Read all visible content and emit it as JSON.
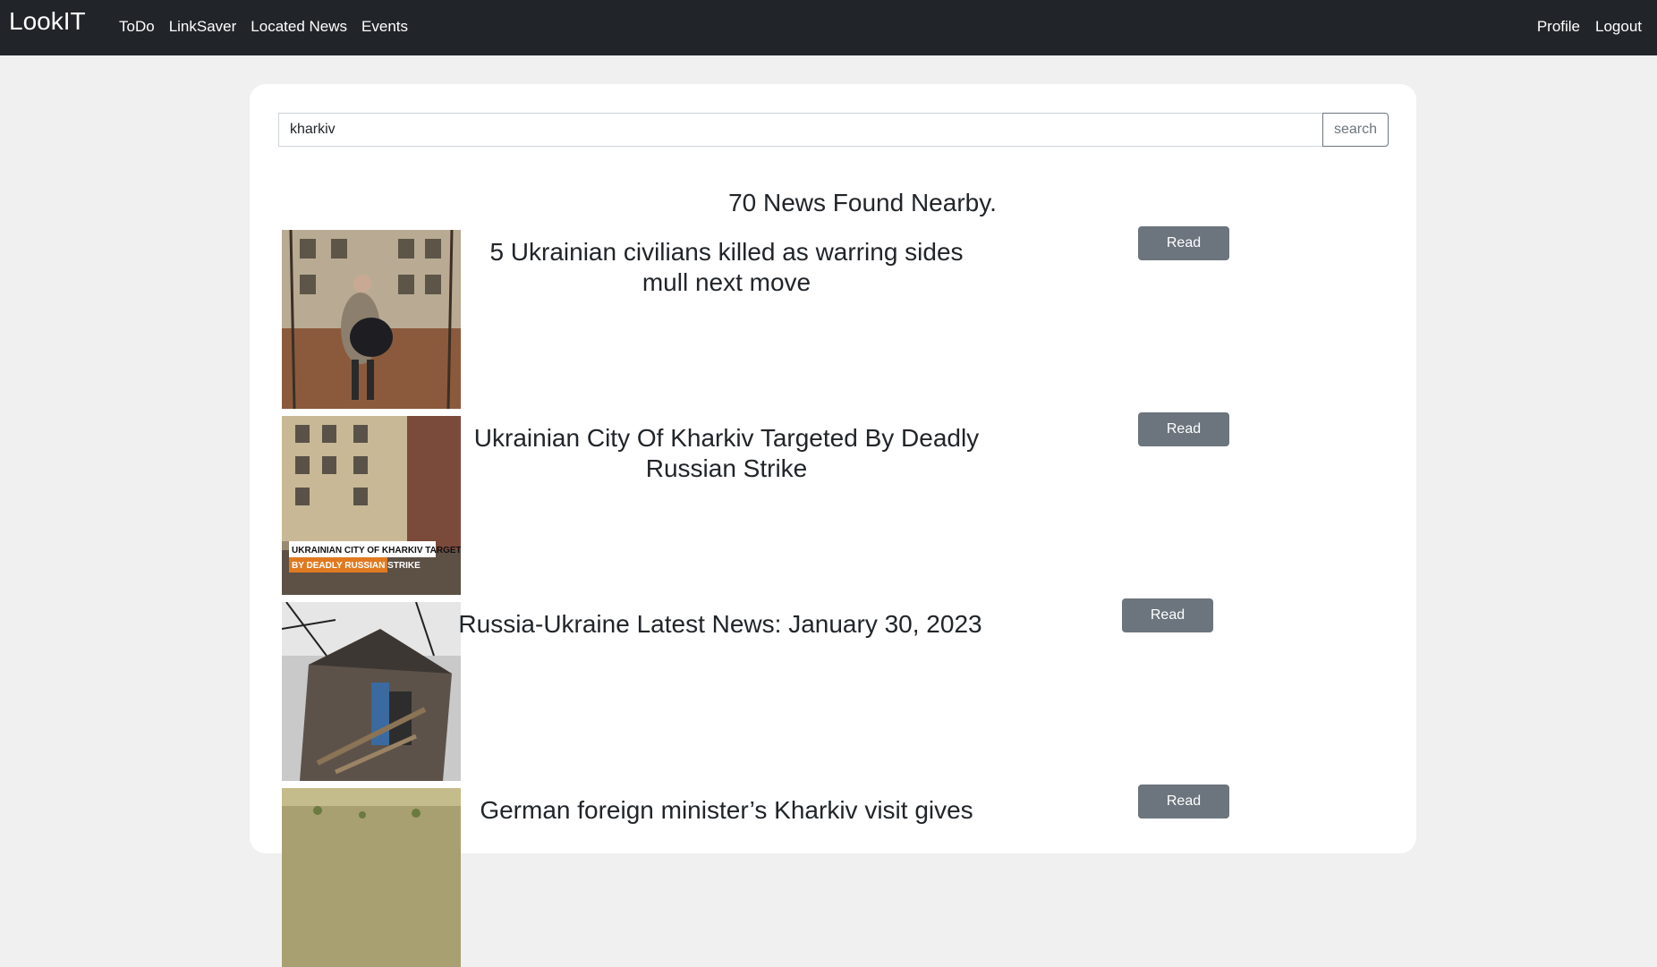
{
  "navbar": {
    "brand": "LookIT",
    "links": [
      "ToDo",
      "LinkSaver",
      "Located News",
      "Events"
    ],
    "right_links": [
      "Profile",
      "Logout"
    ]
  },
  "search": {
    "value": "kharkiv",
    "button_label": "search"
  },
  "results": {
    "count_text": "70 News Found Nearby."
  },
  "news": [
    {
      "title": "5 Ukrainian civilians killed as warring sides mull next move",
      "button": "Read"
    },
    {
      "title": "Ukrainian City Of Kharkiv Targeted By Deadly Russian Strike",
      "button": "Read",
      "caption_line1": "UKRAINIAN CITY OF KHARKIV TARGETED",
      "caption_line2": "BY DEADLY RUSSIAN STRIKE"
    },
    {
      "title": "Russia-Ukraine Latest News: January 30, 2023",
      "button": "Read"
    },
    {
      "title": "German foreign minister’s Kharkiv visit gives",
      "button": "Read"
    }
  ]
}
